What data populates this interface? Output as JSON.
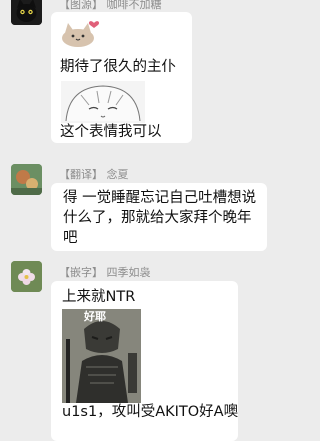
{
  "messages": [
    {
      "name": "【图源】 咖啡不加糖",
      "line1": "期待了很久的主仆",
      "line2": "这个表情我可以"
    },
    {
      "name": "【翻译】 念夏",
      "lines": [
        "得 一觉睡醒忘记自己吐槽想说",
        "什么了，那就给大家拜个晚年",
        "吧"
      ]
    },
    {
      "name": "【嵌字】 四季如袅",
      "line1": "上来就NTR",
      "sticker_text": "好耶",
      "line2": "u1s1，攻叫受AKITO好A噢"
    }
  ]
}
